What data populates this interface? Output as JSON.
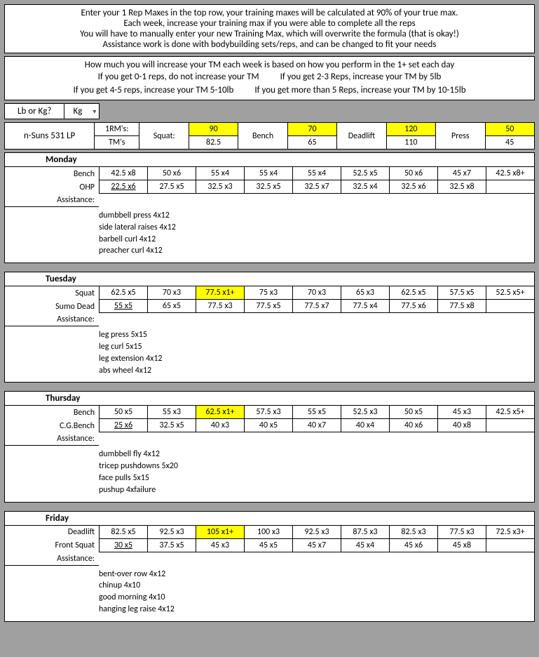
{
  "intro": [
    "Enter your 1 Rep Maxes in the top row, your training maxes will be calculated at 90% of your true max.",
    "Each week, increase your training max if you were able to complete all the reps",
    "You will have to manually enter your new Training Max, which will overwrite the formula (that is okay!)",
    "Assistance work is done with bodybuilding sets/reps, and can be changed to fit your needs"
  ],
  "rules": {
    "top": "How much you will increase your TM each week is based on how you perform in the 1+ set each day",
    "pairs": [
      [
        "If you get 0-1 reps, do not increase your TM",
        "If you get 2-3 Reps, increase your TM by 5lb"
      ],
      [
        "If you get 4-5 reps, increase your TM 5-10lb",
        "If you get more than 5 Reps, increase your TM by 10-15lb"
      ]
    ]
  },
  "unit_label": "Lb or Kg?",
  "unit_value": "Kg",
  "program": "n-Suns 531 LP",
  "tm_labels": [
    "1RM's:",
    "TM's"
  ],
  "lifts": [
    {
      "name": "Squat:",
      "rm": "90",
      "tm": "82.5"
    },
    {
      "name": "Bench",
      "rm": "70",
      "tm": "65"
    },
    {
      "name": "Deadlift",
      "rm": "120",
      "tm": "110"
    },
    {
      "name": "Press",
      "rm": "50",
      "tm": "45"
    }
  ],
  "days": [
    {
      "name": "Monday",
      "rows": [
        {
          "label": "Bench",
          "cells": [
            "42.5  x8",
            "50  x6",
            "55  x4",
            "55  x4",
            "55  x4",
            "52.5  x5",
            "50  x6",
            "45  x7",
            "42.5  x8+"
          ]
        },
        {
          "label": "OHP",
          "cells": [
            "22.5  x6",
            "27.5  x5",
            "32.5  x3",
            "32.5  x5",
            "32.5  x7",
            "32.5  x4",
            "32.5  x6",
            "32.5  x8",
            ""
          ],
          "ul": true
        }
      ],
      "assist": [
        "dumbbell press 4x12",
        "side lateral raises 4x12",
        "barbell curl 4x12",
        "preacher curl 4x12"
      ]
    },
    {
      "name": "Tuesday",
      "rows": [
        {
          "label": "Squat",
          "cells": [
            "62.5  x5",
            "70  x3",
            "77.5  x1+",
            "75  x3",
            "70  x3",
            "65  x3",
            "62.5  x5",
            "57.5  x5",
            "52.5  x5+"
          ],
          "hl": 2
        },
        {
          "label": "Sumo Dead",
          "cells": [
            "55  x5",
            "65  x5",
            "77.5  x3",
            "77.5  x5",
            "77.5  x7",
            "77.5  x4",
            "77.5  x6",
            "77.5  x8",
            ""
          ],
          "ul": true
        }
      ],
      "assist": [
        "leg press 5x15",
        "leg curl 5x15",
        "leg extension 4x12",
        "abs wheel 4x12"
      ]
    },
    {
      "name": "Thursday",
      "rows": [
        {
          "label": "Bench",
          "cells": [
            "50  x5",
            "55  x3",
            "62.5  x1+",
            "57.5  x3",
            "55  x5",
            "52.5  x3",
            "50  x5",
            "45  x3",
            "42.5  x5+"
          ],
          "hl": 2
        },
        {
          "label": "C.G.Bench",
          "cells": [
            "25  x6",
            "32.5  x5",
            "40  x3",
            "40  x5",
            "40  x7",
            "40  x4",
            "40  x6",
            "40  x8",
            ""
          ],
          "ul": true
        }
      ],
      "assist": [
        "dumbbell fly 4x12",
        "tricep pushdowns 5x20",
        "face pulls 5x15",
        "pushup 4xfailure"
      ]
    },
    {
      "name": "Friday",
      "rows": [
        {
          "label": "Deadlift",
          "cells": [
            "82.5  x5",
            "92.5  x3",
            "105  x1+",
            "100  x3",
            "92.5  x3",
            "87.5  x3",
            "82.5  x3",
            "77.5  x3",
            "72.5  x3+"
          ],
          "hl": 2
        },
        {
          "label": "Front Squat",
          "cells": [
            "30  x5",
            "37.5  x5",
            "45  x3",
            "45  x5",
            "45  x7",
            "45  x4",
            "45  x6",
            "45  x8",
            ""
          ],
          "ul": true
        }
      ],
      "assist": [
        "bent-over row 4x12",
        "chinup 4x10",
        "good morning 4x10",
        "hanging leg raise 4x12"
      ]
    }
  ]
}
